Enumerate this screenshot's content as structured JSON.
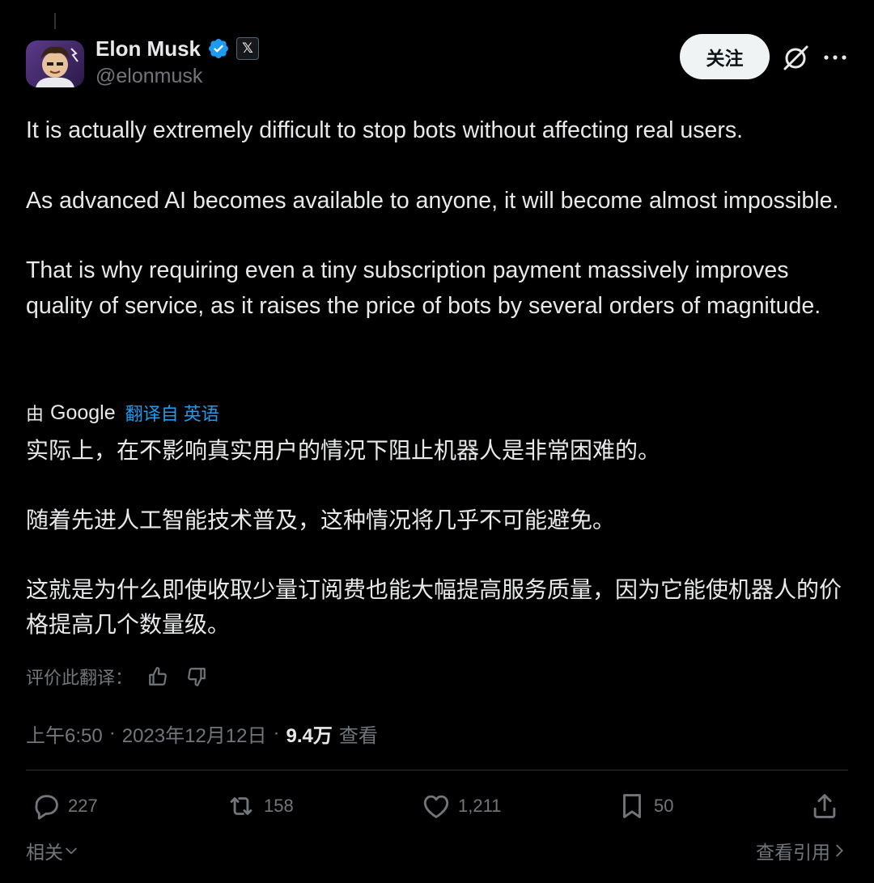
{
  "author": {
    "name": "Elon Musk",
    "handle": "@elonmusk",
    "affiliate_badge": "𝕏"
  },
  "header": {
    "follow_label": "关注",
    "grok_icon": "grok-slash-icon",
    "more_icon": "more-dots-icon"
  },
  "tweet": {
    "paragraphs": [
      "It is actually extremely difficult to stop bots without affecting real users.",
      "As advanced AI becomes available to anyone, it will become almost impossible.",
      "That is why requiring even a tiny subscription payment massively improves quality of service, as it raises the price of bots by several orders of magnitude."
    ]
  },
  "translation": {
    "by_label": "由",
    "provider": "Google",
    "link_text": "翻译自 英语",
    "paragraphs": [
      "实际上，在不影响真实用户的情况下阻止机器人是非常困难的。",
      "随着先进人工智能技术普及，这种情况将几乎不可能避免。",
      "这就是为什么即使收取少量订阅费也能大幅提高服务质量，因为它能使机器人的价格提高几个数量级。"
    ],
    "rate_label": "评价此翻译："
  },
  "meta": {
    "time": "上午6:50",
    "date": "2023年12月12日",
    "separator": "·",
    "views_count": "9.4万",
    "views_label": "查看"
  },
  "actions": {
    "replies": "227",
    "reposts": "158",
    "likes": "1,211",
    "bookmarks": "50"
  },
  "footer": {
    "related_label": "相关",
    "quotes_label": "查看引用"
  },
  "colors": {
    "background": "#000000",
    "text": "#e7e9ea",
    "muted": "#71767b",
    "link": "#1d9bf0",
    "verified": "#1d9bf0",
    "divider": "#2f3336"
  }
}
